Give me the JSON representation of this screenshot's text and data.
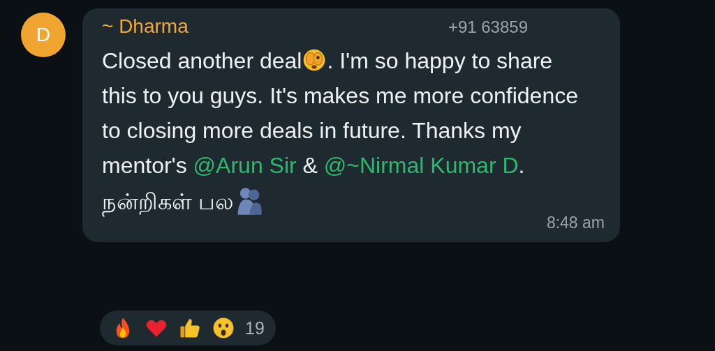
{
  "avatar": {
    "initial": "D"
  },
  "message": {
    "sender": "~ Dharma",
    "phone": "+91 63859",
    "parts": [
      {
        "kind": "text",
        "text": "Closed another deal"
      },
      {
        "kind": "emoji"
      },
      {
        "kind": "text",
        "text": ". I'm so happy to share this to you guys. It's makes me more confidence to closing more deals in future. Thanks my mentor's "
      },
      {
        "kind": "mention",
        "text": "@Arun Sir"
      },
      {
        "kind": "text",
        "text": " & "
      },
      {
        "kind": "mention",
        "text": "@~Nirmal Kumar D"
      },
      {
        "kind": "text",
        "text": "."
      }
    ],
    "closing": [
      {
        "kind": "text",
        "text": "நன்றிகள் பல"
      },
      {
        "kind": "emoji"
      }
    ],
    "time": "8:48 am"
  },
  "reactions": {
    "count": "19"
  }
}
